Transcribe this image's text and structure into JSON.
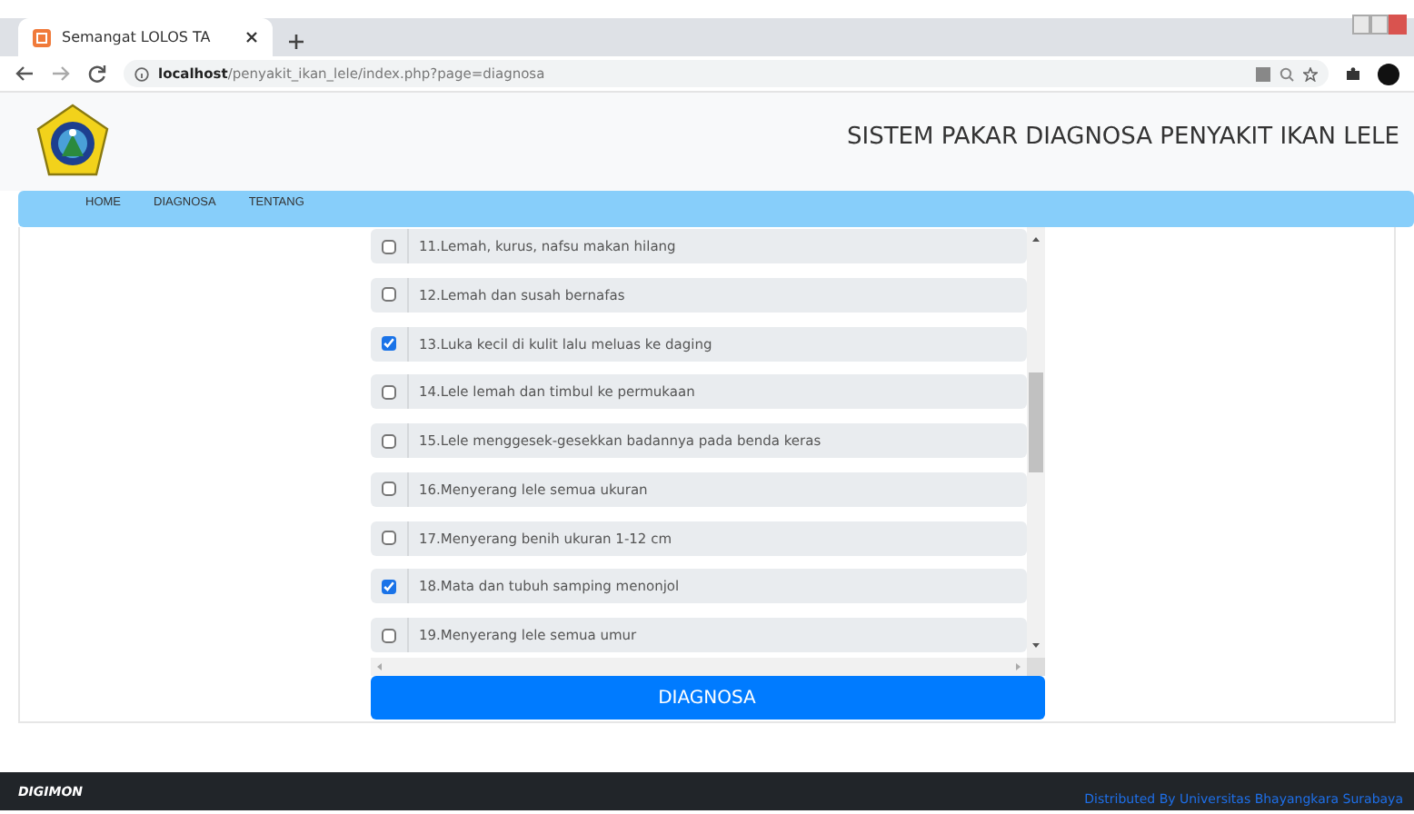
{
  "browser": {
    "tab_title": "Semangat LOLOS TA",
    "url_host": "localhost",
    "url_path": "/penyakit_ikan_lele/index.php?page=diagnosa"
  },
  "header": {
    "title": "SISTEM PAKAR DIAGNOSA PENYAKIT IKAN LELE"
  },
  "nav": [
    "HOME",
    "DIAGNOSA",
    "TENTANG"
  ],
  "symptoms": [
    {
      "label": "11.Lemah, kurus, nafsu makan hilang",
      "checked": false
    },
    {
      "label": "12.Lemah dan susah bernafas",
      "checked": false
    },
    {
      "label": "13.Luka kecil di kulit lalu meluas ke daging",
      "checked": true
    },
    {
      "label": "14.Lele lemah dan timbul ke permukaan",
      "checked": false
    },
    {
      "label": "15.Lele menggesek-gesekkan badannya pada benda keras",
      "checked": false
    },
    {
      "label": "16.Menyerang lele semua ukuran",
      "checked": false
    },
    {
      "label": "17.Menyerang benih ukuran 1-12 cm",
      "checked": false
    },
    {
      "label": "18.Mata dan tubuh samping menonjol",
      "checked": true
    },
    {
      "label": "19.Menyerang lele semua umur",
      "checked": false
    }
  ],
  "submit_button": "DIAGNOSA",
  "footer": {
    "brand": "DIGIMON",
    "credit": "Distributed By Universitas Bhayangkara Surabaya"
  }
}
